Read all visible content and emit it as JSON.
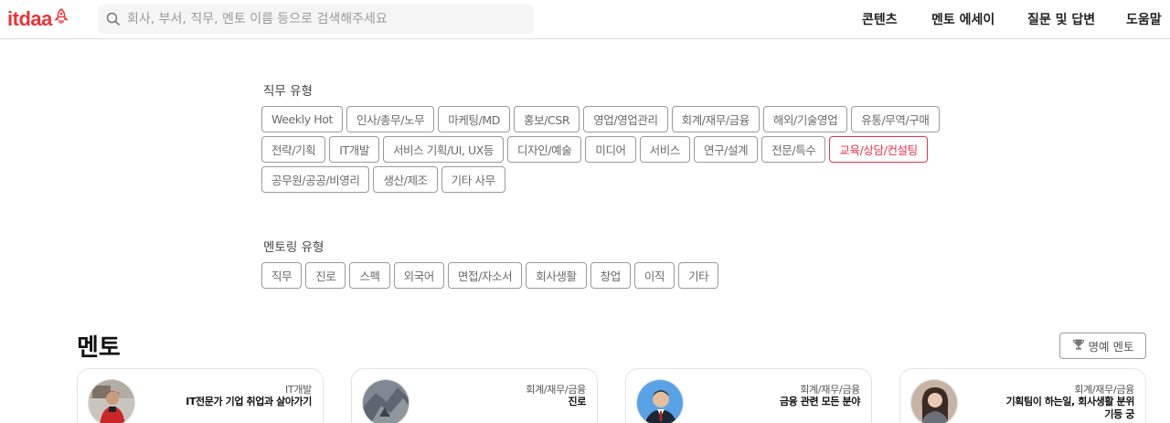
{
  "header": {
    "logo_text": "itdaa",
    "search_placeholder": "회사, 부서, 직무, 멘토 이름 등으로 검색해주세요",
    "nav": [
      "콘텐츠",
      "멘토 에세이",
      "질문 및 답변",
      "도움말"
    ]
  },
  "job_filter": {
    "title": "직무 유형",
    "chips": [
      {
        "label": "Weekly Hot",
        "active": false
      },
      {
        "label": "인사/총무/노무",
        "active": false
      },
      {
        "label": "마케팅/MD",
        "active": false
      },
      {
        "label": "홍보/CSR",
        "active": false
      },
      {
        "label": "영업/영업관리",
        "active": false
      },
      {
        "label": "회계/재무/금융",
        "active": false
      },
      {
        "label": "해외/기술영업",
        "active": false
      },
      {
        "label": "유통/무역/구매",
        "active": false
      },
      {
        "label": "전략/기획",
        "active": false
      },
      {
        "label": "IT개발",
        "active": false
      },
      {
        "label": "서비스 기획/UI, UX등",
        "active": false
      },
      {
        "label": "디자인/예술",
        "active": false
      },
      {
        "label": "미디어",
        "active": false
      },
      {
        "label": "서비스",
        "active": false
      },
      {
        "label": "연구/설계",
        "active": false
      },
      {
        "label": "전문/특수",
        "active": false
      },
      {
        "label": "교육/상담/컨설팅",
        "active": true
      },
      {
        "label": "공무원/공공/비영리",
        "active": false
      },
      {
        "label": "생산/제조",
        "active": false
      },
      {
        "label": "기타 사무",
        "active": false
      }
    ]
  },
  "mentoring_filter": {
    "title": "멘토링 유형",
    "chips": [
      {
        "label": "직무"
      },
      {
        "label": "진로"
      },
      {
        "label": "스펙"
      },
      {
        "label": "외국어"
      },
      {
        "label": "면접/자소서"
      },
      {
        "label": "회사생활"
      },
      {
        "label": "창업"
      },
      {
        "label": "이직"
      },
      {
        "label": "기타"
      }
    ]
  },
  "mentors": {
    "heading": "멘토",
    "honor_button": "명예 멘토",
    "cards": [
      {
        "category": "IT개발",
        "title": "IT전문가 기업 취업과 살아가기",
        "avatar": "mentor-photo-red-jacket"
      },
      {
        "category": "회계/재무/금융",
        "title": "진로",
        "avatar": "mentor-photo-rocks"
      },
      {
        "category": "회계/재무/금융",
        "title": "금융 관련 모든 분야",
        "avatar": "mentor-photo-suit"
      },
      {
        "category": "회계/재무/금융",
        "title": "기획팀이 하는일, 회사생활 분위기등 궁",
        "avatar": "mentor-photo-woman"
      }
    ]
  },
  "colors": {
    "brand": "#e8343b",
    "active_chip": "#e8344e"
  }
}
